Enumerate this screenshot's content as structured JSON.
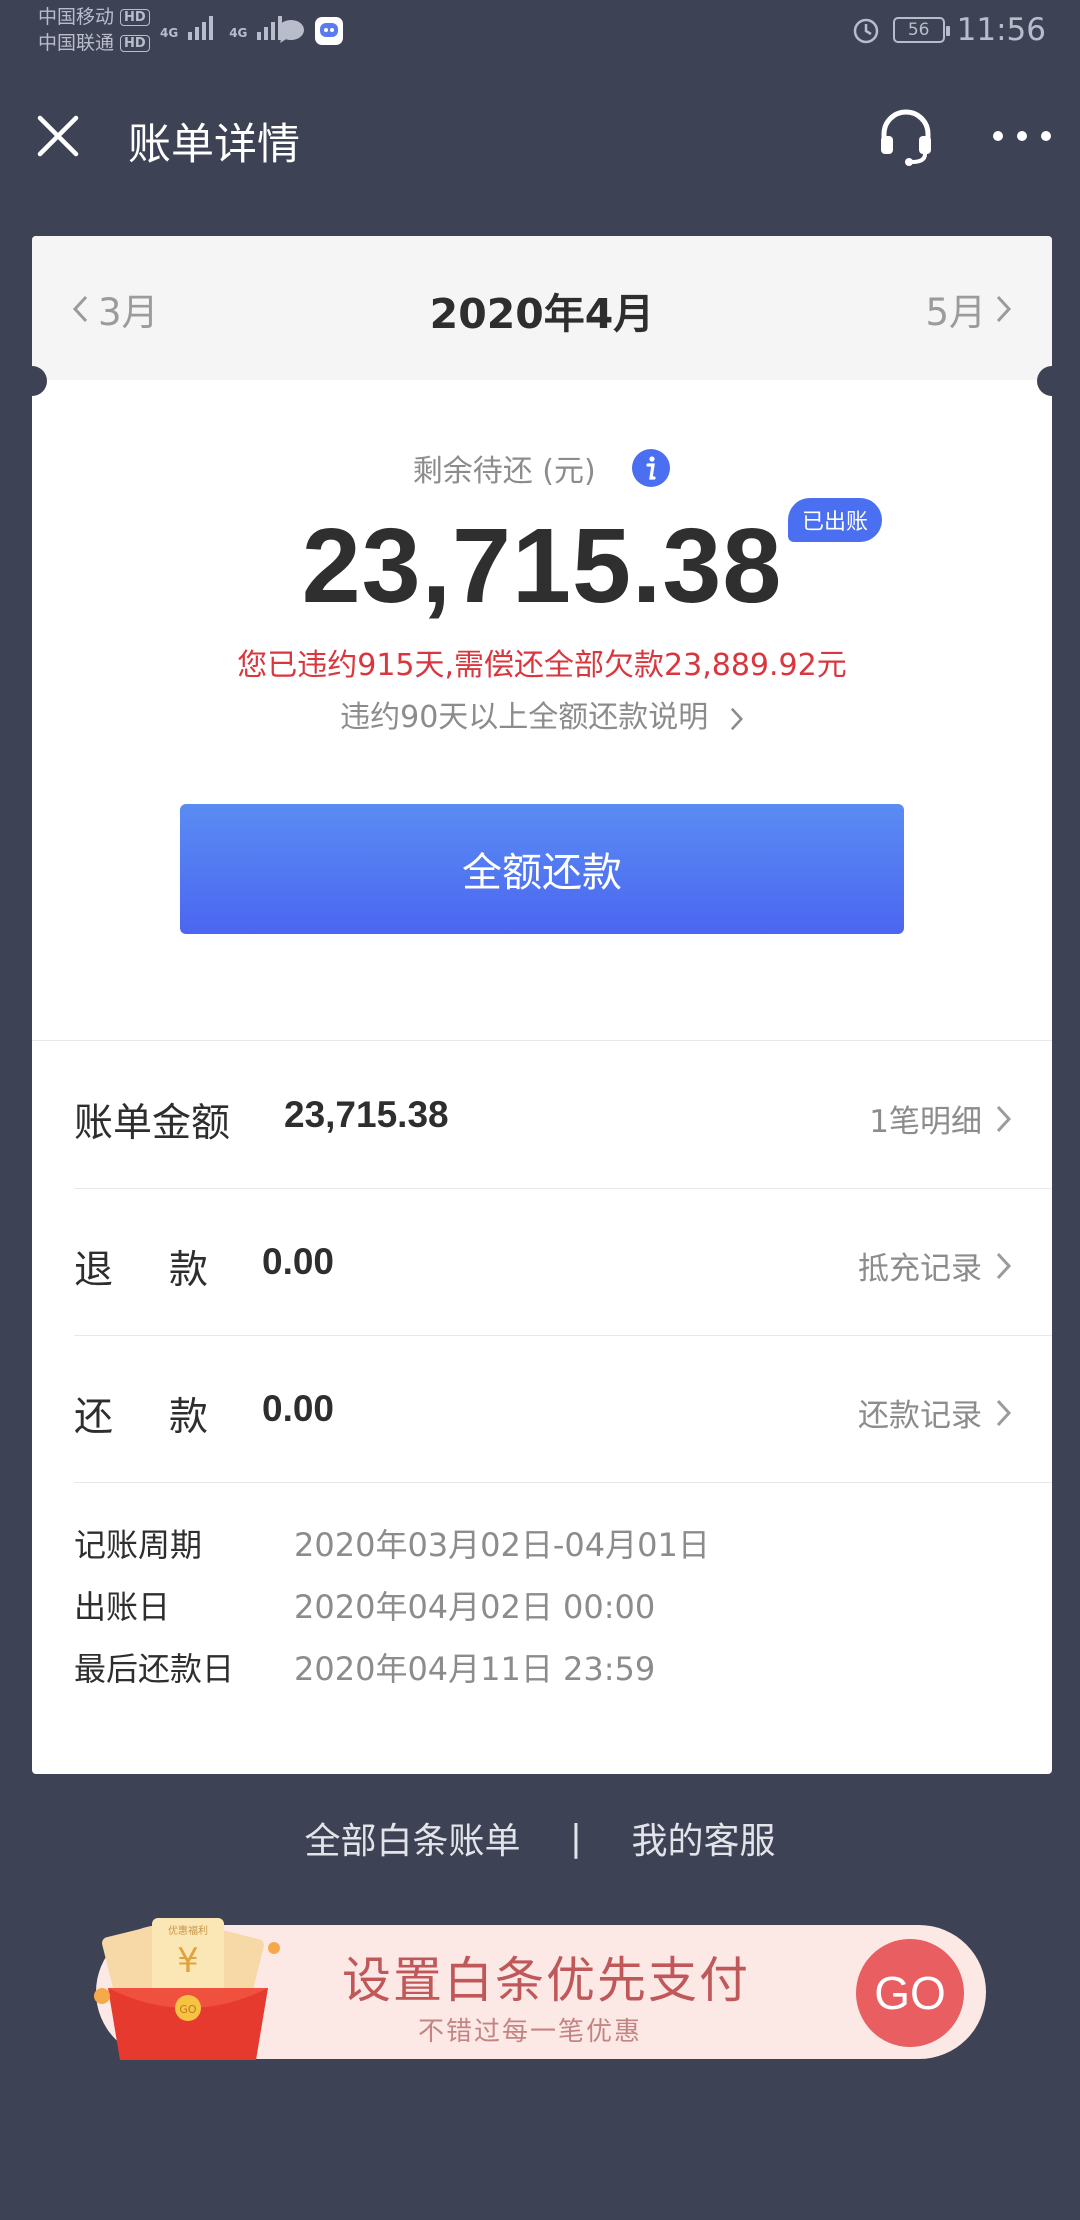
{
  "status_bar": {
    "carrier1": "中国移动",
    "carrier2": "中国联通",
    "hd": "HD",
    "network1": "4G",
    "network2": "4G",
    "battery": "56",
    "time": "11:56"
  },
  "nav": {
    "title": "账单详情"
  },
  "month_bar": {
    "prev": "3月",
    "current": "2020年4月",
    "next": "5月"
  },
  "summary": {
    "remaining_label": "剩余待还 (元)",
    "amount": "23,715.38",
    "badge": "已出账",
    "overdue_notice": "您已违约915天,需偿还全部欠款23,889.92元",
    "overdue_link": "违约90天以上全额还款说明",
    "pay_button": "全额还款"
  },
  "rows": [
    {
      "label": "账单金额",
      "value": "23,715.38",
      "link": "1笔明细"
    },
    {
      "label": "退款",
      "value": "0.00",
      "link": "抵充记录"
    },
    {
      "label": "还款",
      "value": "0.00",
      "link": "还款记录"
    }
  ],
  "dates": [
    {
      "label": "记账周期",
      "value": "2020年03月02日-04月01日"
    },
    {
      "label": "出账日",
      "value": "2020年04月02日 00:00"
    },
    {
      "label": "最后还款日",
      "value": "2020年04月11日 23:59"
    }
  ],
  "footer": {
    "all_bills": "全部白条账单",
    "divider": "|",
    "customer_service": "我的客服"
  },
  "promo": {
    "title": "设置白条优先支付",
    "subtitle": "不错过每一笔优惠",
    "go": "GO",
    "envelope_text": "优惠福利"
  },
  "colors": {
    "background": "#3e4255",
    "accent_blue": "#4b66f1",
    "overdue_red": "#d9363e",
    "promo_red": "#e85e61"
  }
}
